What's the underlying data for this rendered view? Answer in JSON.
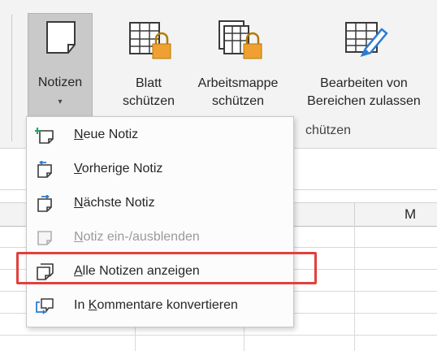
{
  "ribbon": {
    "buttons": {
      "notizen": {
        "label": "Notizen",
        "caret": "▾"
      },
      "blatt": {
        "line1": "Blatt",
        "line2": "schützen"
      },
      "mappe": {
        "line1": "Arbeitsmappe",
        "line2": "schützen"
      },
      "bearbeiten": {
        "line1": "Bearbeiten von",
        "line2": "Bereichen zulassen"
      }
    },
    "group_label": "chützen"
  },
  "sheet": {
    "column_letters": [
      "M"
    ]
  },
  "menu": {
    "items": [
      {
        "pre": "",
        "key": "N",
        "post": "eue Notiz",
        "disabled": false,
        "icon": "new-note-icon"
      },
      {
        "pre": "",
        "key": "V",
        "post": "orherige Notiz",
        "disabled": false,
        "icon": "previous-note-icon"
      },
      {
        "pre": "",
        "key": "N",
        "post": "ächste Notiz",
        "disabled": false,
        "icon": "next-note-icon"
      },
      {
        "pre": "",
        "key": "N",
        "post": "otiz ein-/ausblenden",
        "disabled": true,
        "icon": "toggle-note-icon"
      },
      {
        "pre": "",
        "key": "A",
        "post": "lle Notizen anzeigen",
        "disabled": false,
        "icon": "show-all-notes-icon"
      },
      {
        "pre": "In ",
        "key": "K",
        "post": "ommentare konvertieren",
        "disabled": false,
        "icon": "convert-comments-icon"
      }
    ]
  },
  "colors": {
    "highlight": "#e2403c",
    "accent_blue": "#2b7cd3",
    "accent_green": "#21a366",
    "lock_orange": "#f0a030"
  }
}
